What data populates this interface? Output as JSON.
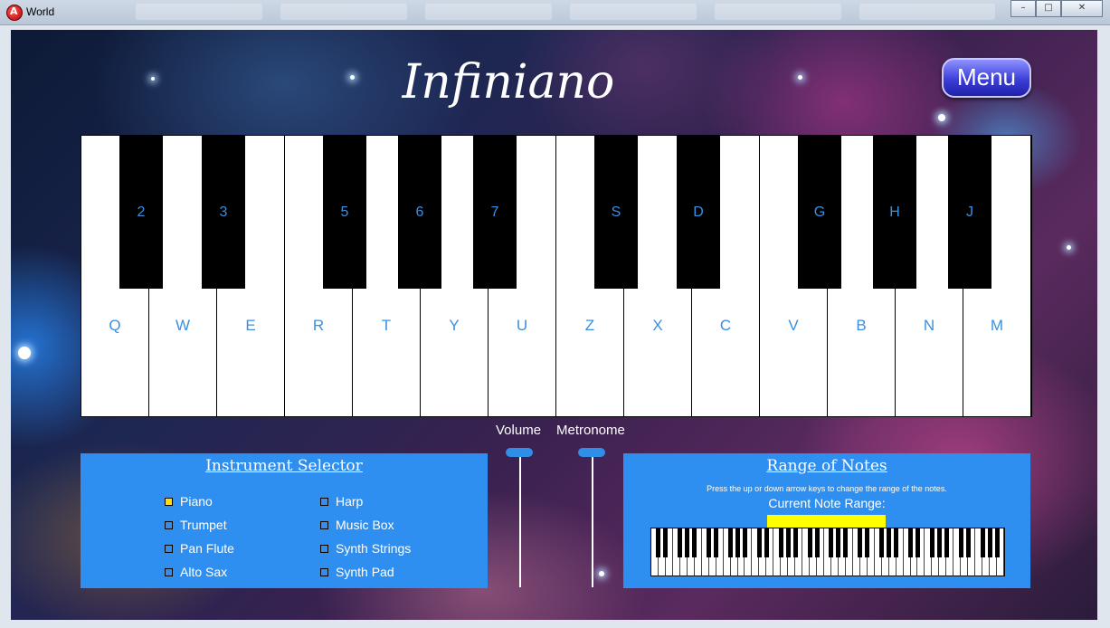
{
  "window": {
    "title": "World",
    "controls": {
      "minimize": "–",
      "maximize": "□",
      "close": "✕"
    }
  },
  "app": {
    "title": "Infiniano",
    "menu_label": "Menu"
  },
  "keyboard": {
    "white_keys": [
      "Q",
      "W",
      "E",
      "R",
      "T",
      "Y",
      "U",
      "Z",
      "X",
      "C",
      "V",
      "B",
      "N",
      "M"
    ],
    "black_keys": [
      "2",
      "3",
      "5",
      "6",
      "7",
      "S",
      "D",
      "G",
      "H",
      "J"
    ]
  },
  "sliders": {
    "volume_label": "Volume",
    "metronome_label": "Metronome"
  },
  "instrument_selector": {
    "title": "Instrument Selector",
    "items": [
      {
        "label": "Piano",
        "selected": true
      },
      {
        "label": "Trumpet",
        "selected": false
      },
      {
        "label": "Pan Flute",
        "selected": false
      },
      {
        "label": "Alto Sax",
        "selected": false
      },
      {
        "label": "Harp",
        "selected": false
      },
      {
        "label": "Music Box",
        "selected": false
      },
      {
        "label": "Synth Strings",
        "selected": false
      },
      {
        "label": "Synth Pad",
        "selected": false
      }
    ]
  },
  "range": {
    "title": "Range of Notes",
    "hint": "Press the up or down arrow keys to change the range of the notes.",
    "current_label": "Current Note Range:",
    "highlight_color": "#ffff00"
  },
  "colors": {
    "panel": "#2f8ff0",
    "key_label": "#3a8fe0",
    "selected_box": "#ffe000"
  }
}
